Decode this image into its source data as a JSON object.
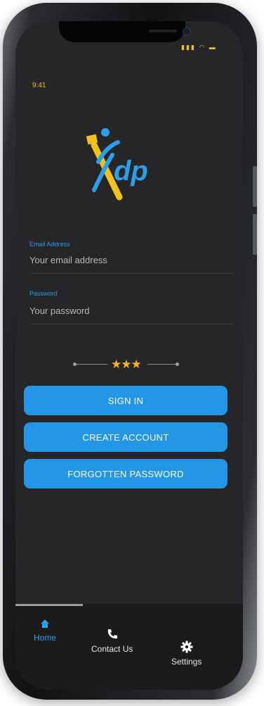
{
  "status_bar": {
    "time": "9:41",
    "icons": [
      "signal-icon",
      "wifi-icon",
      "battery-icon"
    ]
  },
  "logo": {
    "text": "dp"
  },
  "email": {
    "label": "Email Address",
    "placeholder": "Your email address"
  },
  "password": {
    "label": "Password",
    "placeholder": "Your password"
  },
  "stars": "★★★",
  "buttons": {
    "sign_in": "SIGN IN",
    "create_account": "CREATE ACCOUNT",
    "forgotten_password": "FORGOTTEN PASSWORD"
  },
  "tabs": [
    {
      "label": "Home",
      "icon": "home-icon",
      "active": true
    },
    {
      "label": "Contact Us",
      "icon": "phone-icon",
      "active": false
    },
    {
      "label": "Settings",
      "icon": "gear-icon",
      "active": false
    }
  ],
  "colors": {
    "accent": "#2496e6",
    "brand_yellow": "#f2c11b",
    "background": "#262628",
    "tabbar": "#1b1b1c"
  }
}
